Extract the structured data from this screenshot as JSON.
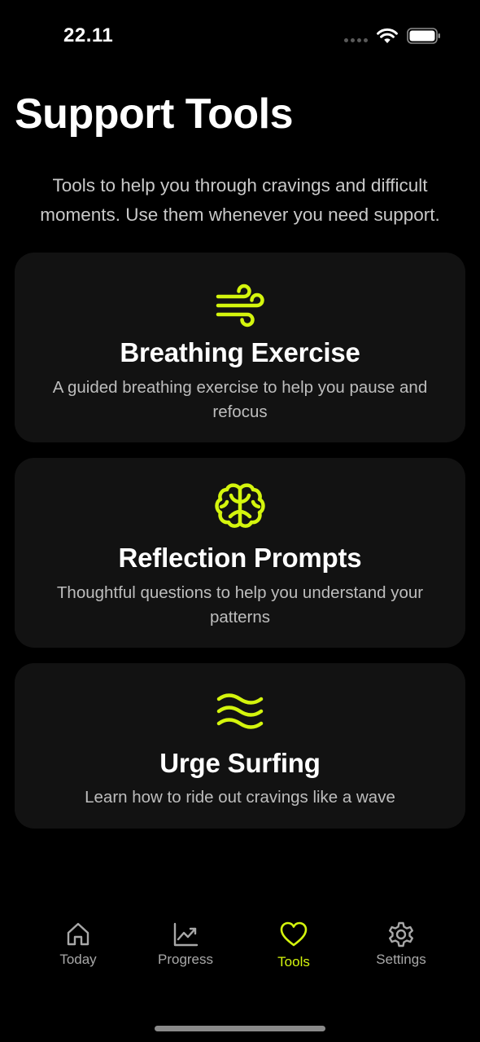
{
  "colors": {
    "accent": "#d4f50d",
    "background": "#000000",
    "card": "#121212",
    "text_secondary": "#bdbdbd",
    "tab_inactive": "#a8a8a8"
  },
  "status_bar": {
    "time": "22.11"
  },
  "header": {
    "title": "Support Tools",
    "subtitle": "Tools to help you through cravings and difficult moments. Use them whenever you need support."
  },
  "tools": [
    {
      "icon": "wind-icon",
      "title": "Breathing Exercise",
      "description": "A guided breathing exercise to help you pause and refocus"
    },
    {
      "icon": "brain-icon",
      "title": "Reflection Prompts",
      "description": "Thoughtful questions to help you understand your patterns"
    },
    {
      "icon": "waves-icon",
      "title": "Urge Surfing",
      "description": "Learn how to ride out cravings like a wave"
    }
  ],
  "tab_bar": {
    "tabs": [
      {
        "label": "Today",
        "icon": "home-icon"
      },
      {
        "label": "Progress",
        "icon": "chart-icon"
      },
      {
        "label": "Tools",
        "icon": "heart-icon",
        "active": true
      },
      {
        "label": "Settings",
        "icon": "gear-icon"
      }
    ]
  }
}
